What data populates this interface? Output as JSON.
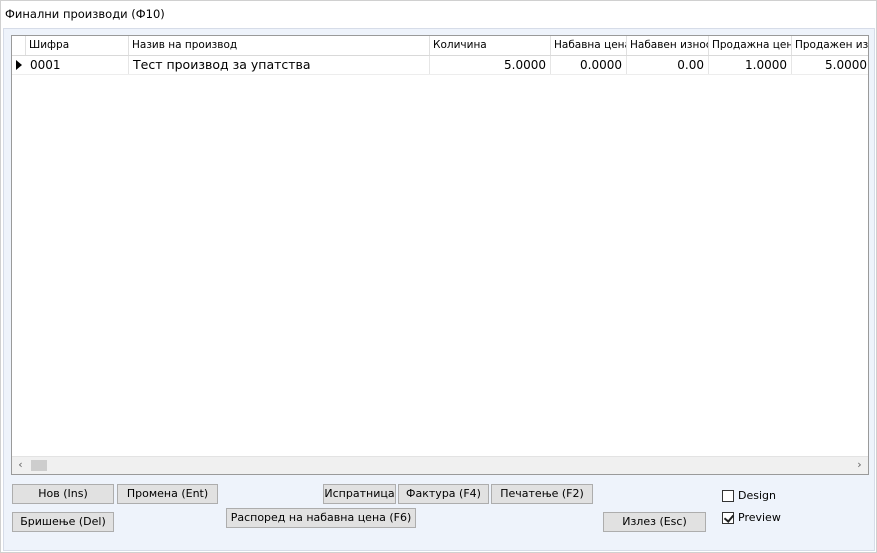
{
  "window": {
    "title": "Финални производи (Ф10)"
  },
  "grid": {
    "columns": [
      {
        "label": "Шифра"
      },
      {
        "label": "Назив на производ"
      },
      {
        "label": "Количина"
      },
      {
        "label": "Набавна цена"
      },
      {
        "label": "Набавен износ"
      },
      {
        "label": "Продажна цена"
      },
      {
        "label": "Продажен износ"
      }
    ],
    "rows": [
      {
        "sifra": "0001",
        "naziv": "Тест производ за упатства",
        "kolicina": "5.0000",
        "nabavna_cena": "0.0000",
        "nabaven_iznos": "0.00",
        "prodazna_cena": "1.0000",
        "prodazen_iznos": "5.0000"
      }
    ],
    "scroll_left": "‹",
    "scroll_right": "›"
  },
  "buttons": {
    "new": "Нов (Ins)",
    "edit": "Промена (Ent)",
    "delete": "Бришење (Del)",
    "dispatch": "Испратница",
    "invoice": "Фактура (F4)",
    "print": "Печатење (F2)",
    "distribute": "Распоред на набавна цена (F6)",
    "exit": "Излез (Esc)"
  },
  "options": {
    "design": {
      "label": "Design",
      "checked": false
    },
    "preview": {
      "label": "Preview",
      "checked": true
    }
  }
}
